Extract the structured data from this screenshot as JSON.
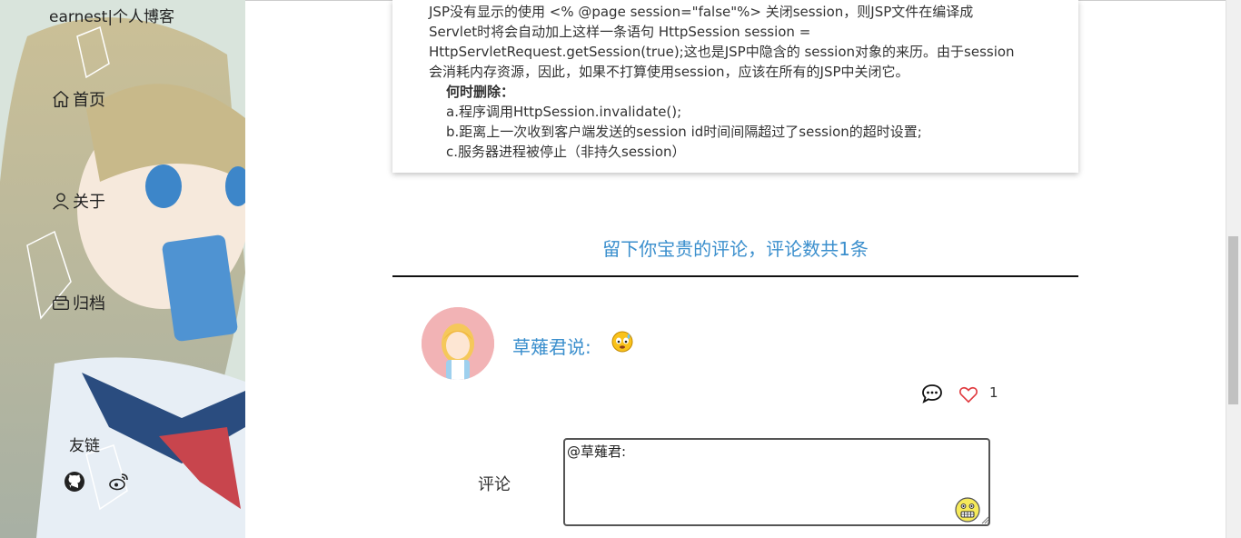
{
  "site": {
    "title": "earnest|个人博客"
  },
  "nav": [
    {
      "label": "首页",
      "icon": "home-icon"
    },
    {
      "label": "关于",
      "icon": "user-icon"
    },
    {
      "label": "归档",
      "icon": "archive-icon"
    }
  ],
  "links": {
    "label": "友链",
    "icons": [
      "github-icon",
      "weibo-icon"
    ]
  },
  "article": {
    "lines": [
      "JSP没有显示的使用 <% @page session=\"false\"%> 关闭session，则JSP文件在编译成",
      "Servlet时将会自动加上这样一条语句 HttpSession session =",
      "HttpServletRequest.getSession(true);这也是JSP中隐含的 session对象的来历。由于session",
      "会消耗内存资源，因此，如果不打算使用session，应该在所有的JSP中关闭它。"
    ],
    "when_delete_heading": "何时删除：",
    "items": [
      "a.程序调用HttpSession.invalidate();",
      "b.距离上一次收到客户端发送的session id时间间隔超过了session的超时设置;",
      "c.服务器进程被停止（非持久session）"
    ]
  },
  "comments": {
    "title": "留下你宝贵的评论，评论数共1条",
    "list": [
      {
        "author": "草薙君说:",
        "emoji": "sweat-emoji",
        "reply_icon": "chat-bubble-icon",
        "like_icon": "heart-icon",
        "likes": "1"
      }
    ]
  },
  "form": {
    "label": "评论",
    "value": "@草薙君:",
    "emoji_button": "grimace-emoji"
  },
  "colors": {
    "accent": "#3b8fcd",
    "heart": "#e0393e"
  }
}
